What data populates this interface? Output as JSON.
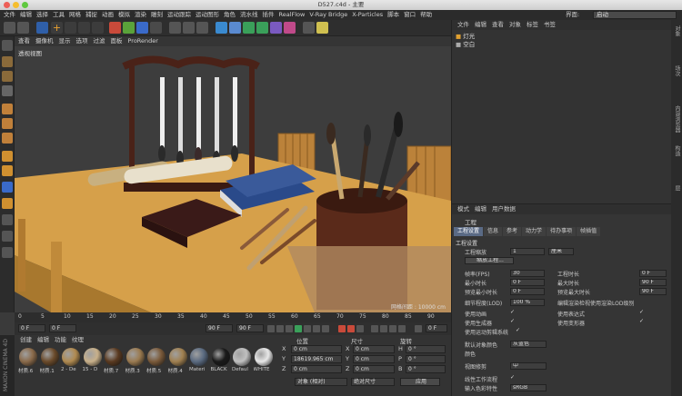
{
  "window": {
    "title": "D527.c4d - 主要"
  },
  "menubar": {
    "items": [
      "文件",
      "编辑",
      "选择",
      "工具",
      "网格",
      "捕捉",
      "动画",
      "模拟",
      "渲染",
      "雕刻",
      "运动跟踪",
      "运动图形",
      "角色",
      "流水线",
      "插件",
      "RealFlow",
      "V-Ray Bridge",
      "X-Particles",
      "脚本",
      "窗口",
      "帮助"
    ],
    "layout_label": "界面:",
    "layout_value": "启动"
  },
  "viewport": {
    "menu": [
      "查看",
      "摄像机",
      "显示",
      "选项",
      "过滤",
      "面板",
      "ProRender"
    ],
    "label": "透视视图",
    "status": "网格间距 : 10000 cm"
  },
  "timeline": {
    "ticks": [
      "0",
      "5",
      "10",
      "15",
      "20",
      "25",
      "30",
      "35",
      "40",
      "45",
      "50",
      "55",
      "60",
      "65",
      "70",
      "75",
      "80",
      "85",
      "90"
    ],
    "start_frame": "0 F",
    "min_frame": "0 F",
    "max_frame": "90 F",
    "end_frame": "90 F",
    "current_frame": "0 F"
  },
  "materials": {
    "menu": [
      "创建",
      "编辑",
      "功能",
      "纹理"
    ],
    "items": [
      {
        "name": "材质.6",
        "color": "#8a6a4a"
      },
      {
        "name": "材质.1",
        "color": "#6a4a2a"
      },
      {
        "name": "2 - De",
        "color": "#b08a50"
      },
      {
        "name": "15 - D",
        "color": "#c8b08a"
      },
      {
        "name": "材质.7",
        "color": "#5a3a20"
      },
      {
        "name": "材质.3",
        "color": "#9a7a50"
      },
      {
        "name": "材质.5",
        "color": "#7a5a3a"
      },
      {
        "name": "材质.4",
        "color": "#a08050"
      },
      {
        "name": "Materi",
        "color": "#5a6a80"
      },
      {
        "name": "BLACK",
        "color": "#1a1a1a"
      },
      {
        "name": "Defaul",
        "color": "#c0c0c0"
      },
      {
        "name": "WHITE",
        "color": "#e8e8e8"
      }
    ],
    "brand": "MAXON CINEMA 4D"
  },
  "coordinates": {
    "headers": {
      "position": "位置",
      "size": "尺寸",
      "rotation": "旋转"
    },
    "rows": [
      {
        "axis": "X",
        "pos": "0 cm",
        "axis2": "X",
        "size": "0 cm",
        "axis3": "H",
        "rot": "0 °"
      },
      {
        "axis": "Y",
        "pos": "18619.965 cm",
        "axis2": "Y",
        "size": "0 cm",
        "axis3": "P",
        "rot": "0 °"
      },
      {
        "axis": "Z",
        "pos": "0 cm",
        "axis2": "Z",
        "size": "0 cm",
        "axis3": "B",
        "rot": "0 °"
      }
    ],
    "mode": "对象 (相对)",
    "size_mode": "绝对尺寸",
    "apply": "应用"
  },
  "objects": {
    "menu": [
      "文件",
      "编辑",
      "查看",
      "对象",
      "标签",
      "书签"
    ],
    "items": [
      {
        "label": "灯光",
        "color": "#e0a030"
      },
      {
        "label": "空白",
        "color": "#aaaaaa"
      }
    ],
    "side_tabs": [
      "对象",
      "场次",
      "内容浏览器",
      "构造",
      "层"
    ]
  },
  "attributes": {
    "menu": [
      "模式",
      "编辑",
      "用户数据"
    ],
    "title": "工程",
    "tabs": [
      "工程设置",
      "信息",
      "参考",
      "动力学",
      "待办事项",
      "帧插值"
    ],
    "section": "工程设置",
    "scale_label": "工程缩放",
    "scale_value": "1",
    "scale_unit": "厘米",
    "scale_button": "缩放工程...",
    "fps_label": "帧率(FPS)",
    "fps_value": "30",
    "min_time_label": "最小时长",
    "min_time_value": "0 F",
    "preview_min_label": "预览最小时长",
    "preview_min_value": "0 F",
    "project_time_label": "工程时长",
    "project_time_value": "0 F",
    "max_time_label": "最大时长",
    "max_time_value": "90 F",
    "preview_max_label": "预览最大时长",
    "preview_max_value": "90 F",
    "lod_label": "细节程度(LOD)",
    "lod_value": "100 %",
    "lod_render_label": "编辑渲染检视使用渲染LOD级别",
    "use_anim_label": "使用动画",
    "use_gen_label": "使用生成器",
    "use_motion_label": "使用运动剪辑系统",
    "use_expr_label": "使用表达式",
    "use_deform_label": "使用变形器",
    "default_color_label": "默认对象颜色",
    "default_color_value": "灰蓝色",
    "color_label": "颜色",
    "view_clip_label": "视图修剪",
    "view_clip_value": "中",
    "linear_label": "线性工作流程",
    "input_color_label": "输入色彩特性",
    "input_color_value": "sRGB"
  }
}
